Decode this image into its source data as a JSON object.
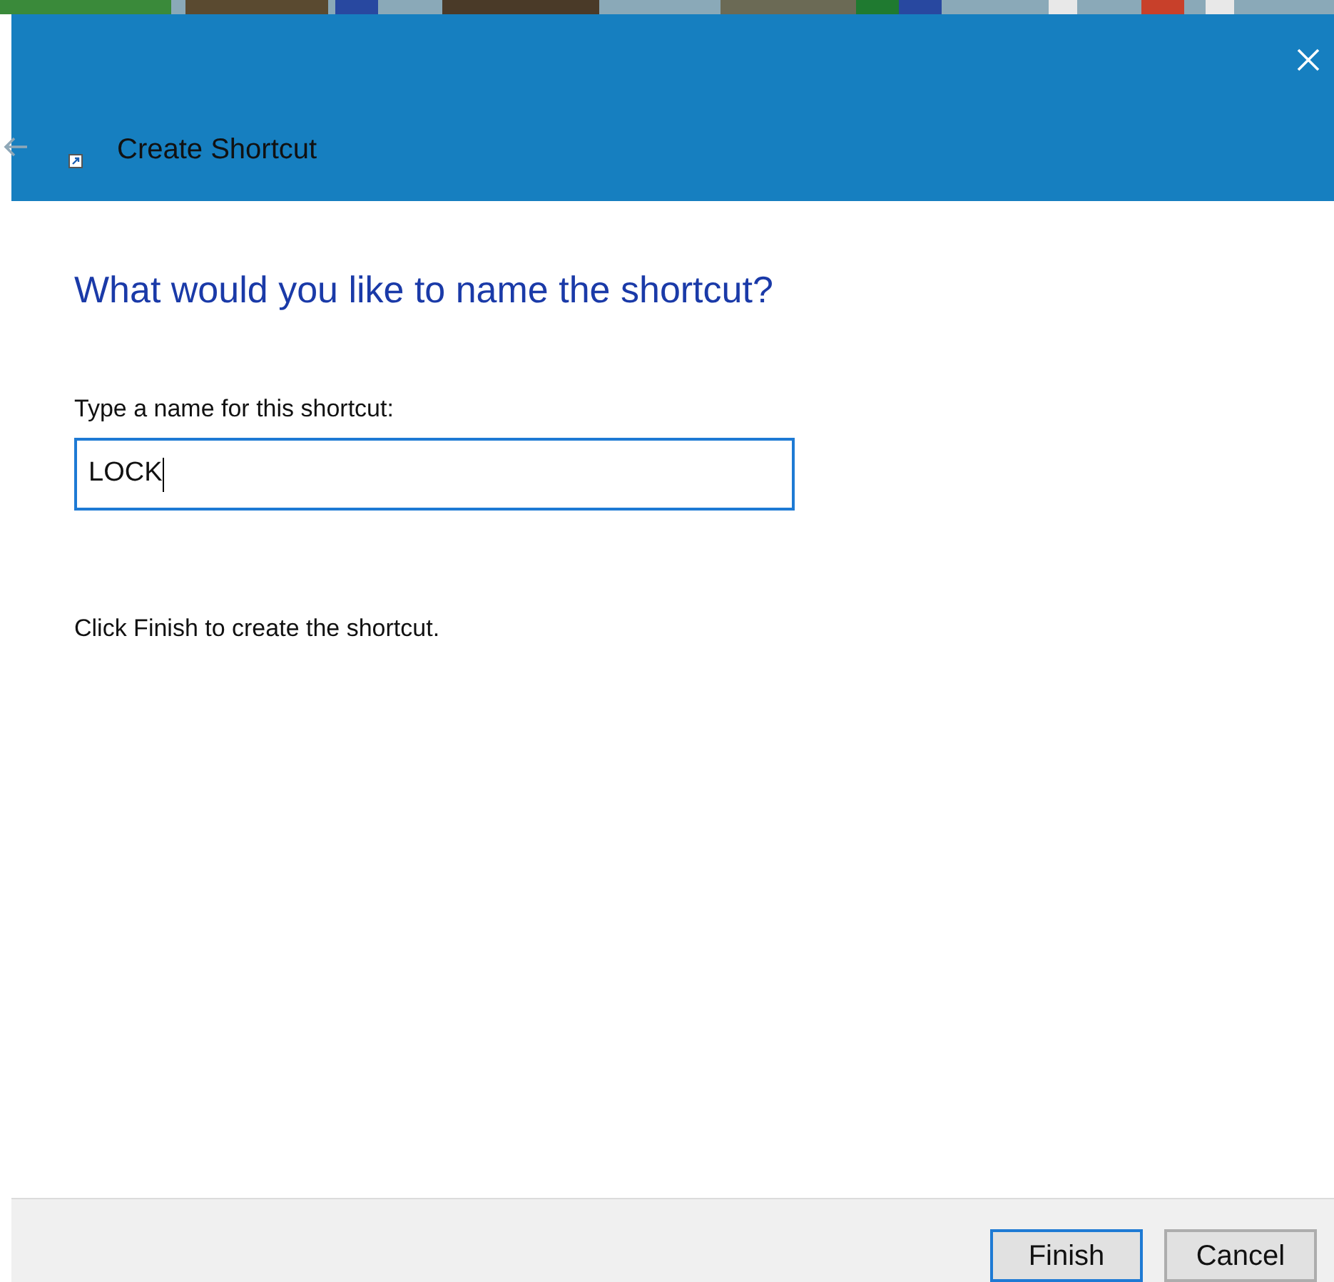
{
  "window": {
    "title": "Create Shortcut"
  },
  "heading": "What would you like to name the shortcut?",
  "name_field": {
    "label": "Type a name for this shortcut:",
    "value": "LOCK",
    "focused": true
  },
  "instruction": "Click Finish to create the shortcut.",
  "buttons": [
    {
      "label": "Finish",
      "default": true
    },
    {
      "label": "Cancel",
      "default": false
    }
  ]
}
